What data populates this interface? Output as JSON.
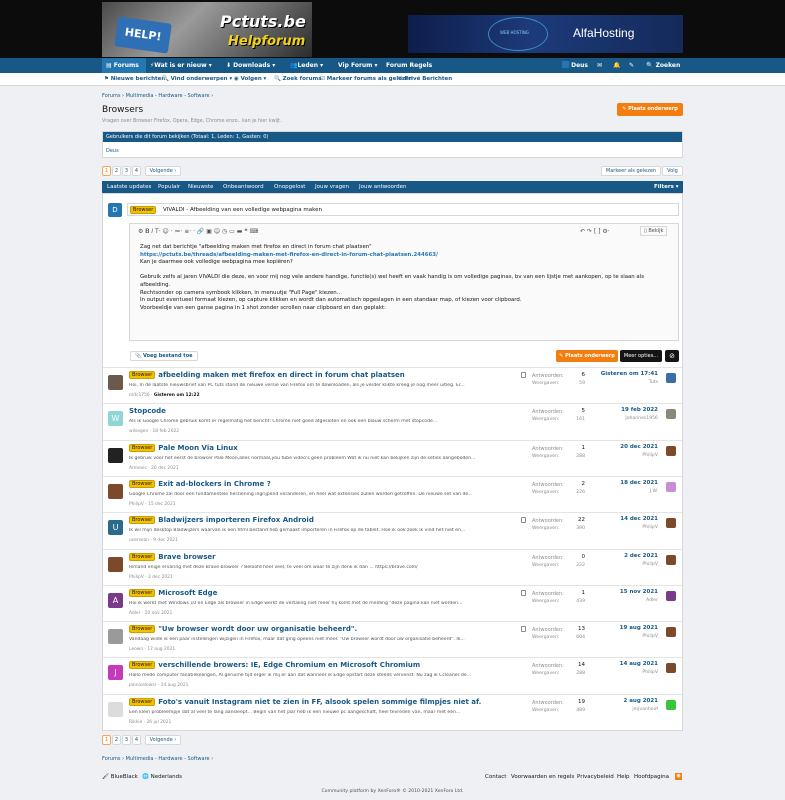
{
  "header": {
    "logo_top": "Pctuts.be",
    "logo_bottom": "Helpforum",
    "logo_key_text": "HELP!",
    "ad_text": "AlfaHosting",
    "ad_sub": "WEB HOSTING"
  },
  "nav": {
    "forums": "Forums",
    "wat_is_er_nieuw": "Wat is er nieuw",
    "downloads": "Downloads",
    "leden": "Leden",
    "vip_forum": "Vip Forum",
    "forum_regels": "Forum Regels",
    "user": "Deus",
    "search": "Zoeken"
  },
  "subnav": {
    "nieuwe_berichten": "Nieuwe berichten",
    "vind_onderwerpen": "Vind onderwerpen",
    "volgen": "Volgen",
    "zoek_forums": "Zoek forums",
    "markeer": "Markeer forums als gelezen",
    "prive": "Privé Berichten"
  },
  "breadcrumb": [
    "Forums",
    "Multimedia - Hardware - Software"
  ],
  "page": {
    "title": "Browsers",
    "description": "Vragen over Browser Firefox, Opera, Edge, Chrome enzo.. kan je hier kwijt.",
    "post_button": "Plaats onderwerp"
  },
  "viewers": {
    "header": "Gebruikers die dit forum bekijken (Totaal: 1, Leden: 1, Gasten: 0)",
    "user": "Deus"
  },
  "pagination": {
    "pages": [
      "1",
      "2",
      "3",
      "4"
    ],
    "next": "Volgende ›",
    "mark_read": "Markeer als gelezen",
    "follow": "Volg"
  },
  "filter_tabs": [
    "Laatste updates",
    "Populair",
    "Nieuwste",
    "Onbeantwoord",
    "Onopgelost",
    "Jouw vragen",
    "Jouw antwoorden"
  ],
  "filters": "Filters ▾",
  "quick": {
    "avatar": "D",
    "prefix": "Browser",
    "title": "VIVALDI - Afbeelding van een volledige webpagina maken",
    "preview": "Bekijk",
    "lines": [
      "Zag net dat berichtje \"afbeelding maken met firefox en direct in forum chat plaatsen\"",
      "https://pctuts.be/threads/afbeelding-maken-met-firefox-en-direct-in-forum-chat-plaatsen.244663/",
      "Kan je daarmee ook volledige webpagina mee kopiëren?",
      "",
      "Gebruik zelfs al jaren VIVALDI die deze, en voor mij nog vele andere handige, functie(s) wel heeft en vaak handig is om volledige paginas, bv van een lijstje met aankopen, op te slaan als",
      "afbeelding.",
      "Rechtsonder op camera symbook klikken, in menuutje \"Full Page\" kiezen..",
      "In output eventueel formaat kiezen, op capture klikken en wordt dan automatisch opgeslagen in een standaar map, of kiezen voor clipboard.",
      "Voorbeeldje van een ganse pagina in 1 shot zonder scrollen naar clipboard en dan geplakt:"
    ],
    "attach": "Voeg bestand toe",
    "post": "Plaats onderwerp",
    "more": "Meer opties..."
  },
  "threads": [
    {
      "av": "",
      "avc": "#6b5a4a",
      "prefix": "Browser",
      "title": "afbeelding maken met firefox en direct in forum chat plaatsen",
      "snippet": "Hoi, In de laatste nieuwsbrief van PC tuts stond de nieuwe versie van Firefox om te downloaden, als je verder klikte kreeg je nog meer uitleg. Er...",
      "author": "mdc1756",
      "date": "Gisteren om 12:22",
      "bold": true,
      "lock": true,
      "replies": "6",
      "views": "59",
      "last_date": "Gisteren om 17:41",
      "last_user": "Tuts",
      "lav": "#3a6ea5"
    },
    {
      "av": "W",
      "avc": "#8fd6d6",
      "prefix": "",
      "title": "Stopcode",
      "snippet": "Als ik Google Chrome gebruik komt er regelmatig het bericht: Chrome niet goed afgesloten en ook een blauw scherm met stopcode...",
      "author": "wilsegen",
      "date": "18 feb 2022",
      "bold": false,
      "lock": false,
      "replies": "5",
      "views": "161",
      "last_date": "19 feb 2022",
      "last_user": "Johannes1956",
      "lav": "#8a8a7a"
    },
    {
      "av": "",
      "avc": "#222",
      "prefix": "Browser",
      "title": "Pale Moon Via Linux",
      "snippet": "Ik gebruik voor het eerst de browser Pale Moon,alles normaal,you tube video's geen probleem Wat ik nu niet kan bekijken zijn de seties aangeboden...",
      "author": "Armevic",
      "date": "20 dec 2021",
      "bold": false,
      "lock": false,
      "replies": "1",
      "views": "288",
      "last_date": "20 dec 2021",
      "last_user": "PhilipV",
      "lav": "#7a4a2a"
    },
    {
      "av": "",
      "avc": "#7a4a2a",
      "prefix": "Browser",
      "title": "Exit ad-blockers in Chrome ?",
      "snippet": "Google Chrome zal door een fundamentele herziening ingrijpend veranderen, en heel wat extensies zullen worden getroffen. De nieuwe set van de...",
      "author": "PhilipV",
      "date": "15 dec 2021",
      "bold": false,
      "lock": false,
      "replies": "2",
      "views": "226",
      "last_date": "18 dec 2021",
      "last_user": "J.W.",
      "lav": "#c78ed6"
    },
    {
      "av": "U",
      "avc": "#2a6a8a",
      "prefix": "Browser",
      "title": "Bladwijzers importeren Firefox Android",
      "snippet": "Ik wil mijn desktop Bladwijzers waarvan ik een html bestand heb gemaakt importeren in Firefox op de tablet. Hoe ik ook zoek ik vind het niet en...",
      "author": "usersean",
      "date": "9 dec 2021",
      "bold": false,
      "lock": true,
      "replies": "22",
      "views": "390",
      "last_date": "14 dec 2021",
      "last_user": "PhilipV",
      "lav": "#7a4a2a"
    },
    {
      "av": "",
      "avc": "#7a4a2a",
      "prefix": "Browser",
      "title": "Brave browser",
      "snippet": "Iemand enige ervaring met deze Brave browser ? Beloofd heel veel, te veel om waar te zijn denk ik dan ... https://brave.com/",
      "author": "PhilipV",
      "date": "2 dec 2021",
      "bold": false,
      "lock": false,
      "replies": "0",
      "views": "222",
      "last_date": "2 dec 2021",
      "last_user": "PhilipV",
      "lav": "#7a4a2a"
    },
    {
      "av": "A",
      "avc": "#7a3a8a",
      "prefix": "Browser",
      "title": "Microsoft Edge",
      "snippet": "Hoi ik werkt met Windows 10 en Edge als browser in Edge werkt de vertaling niet meer hij komt met de melding \"deze pagina kan niet worden...",
      "author": "Adler",
      "date": "10 nov 2021",
      "bold": false,
      "lock": true,
      "replies": "1",
      "views": "439",
      "last_date": "15 nov 2021",
      "last_user": "Adler",
      "lav": "#7a3a8a"
    },
    {
      "av": "",
      "avc": "#9a9a9a",
      "prefix": "Browser",
      "title": "\"Uw browser wordt door uw organisatie beheerd\".",
      "snippet": "Vandaag wilde ik een paar instellingen wijzigen in Firefox, maar dat ging opeens niet meer. \"Uw browser wordt door uw organisatie beheerd\". Ik...",
      "author": "Leown",
      "date": "17 aug 2021",
      "bold": false,
      "lock": true,
      "replies": "13",
      "views": "604",
      "last_date": "19 aug 2021",
      "last_user": "PhilipV",
      "lav": "#7a4a2a"
    },
    {
      "av": "J",
      "avc": "#c43ab8",
      "prefix": "Browser",
      "title": "verschillende browers: IE, Edge Chromium en Microsoft Chromium",
      "snippet": "Hallo mede computer fanatiekelingen, Al geruime tijd erger ik mij er aan dat wanneer ik Edge opstart deze steeds vervenst. Nu zag ik Ccleaner de...",
      "author": "jannicelowsr",
      "date": "14 aug 2021",
      "bold": false,
      "lock": false,
      "replies": "14",
      "views": "288",
      "last_date": "14 aug 2021",
      "last_user": "PhilipV",
      "lav": "#7a4a2a"
    },
    {
      "av": "",
      "avc": "#dcdcdc",
      "prefix": "Browser",
      "title": "Foto's vanuit Instagram niet te zien in FF, alsook spelen sommige filmpjes niet af.",
      "snippet": "Een klein probleempje dat al veel te lang aansleept... Begin van het jaar heb ik een nieuwe pc aangeschaft, heel tevreden van, maar met één...",
      "author": "Rikkie",
      "date": "26 jul 2021",
      "bold": false,
      "lock": false,
      "replies": "19",
      "views": "489",
      "last_date": "2 aug 2021",
      "last_user": "jmjvanhoof",
      "lav": "#3ac43a"
    }
  ],
  "stats": {
    "replies_label": "Antwoorden:",
    "views_label": "Weergaven:"
  },
  "footer": {
    "style": "BlueBlack",
    "lang": "Nederlands",
    "links": [
      "Contact",
      "Voorwaarden en regels",
      "Privacybeleid",
      "Help",
      "Hoofdpagina"
    ],
    "copyright": "Community platform by XenForo® © 2010-2021 XenForo Ltd."
  }
}
